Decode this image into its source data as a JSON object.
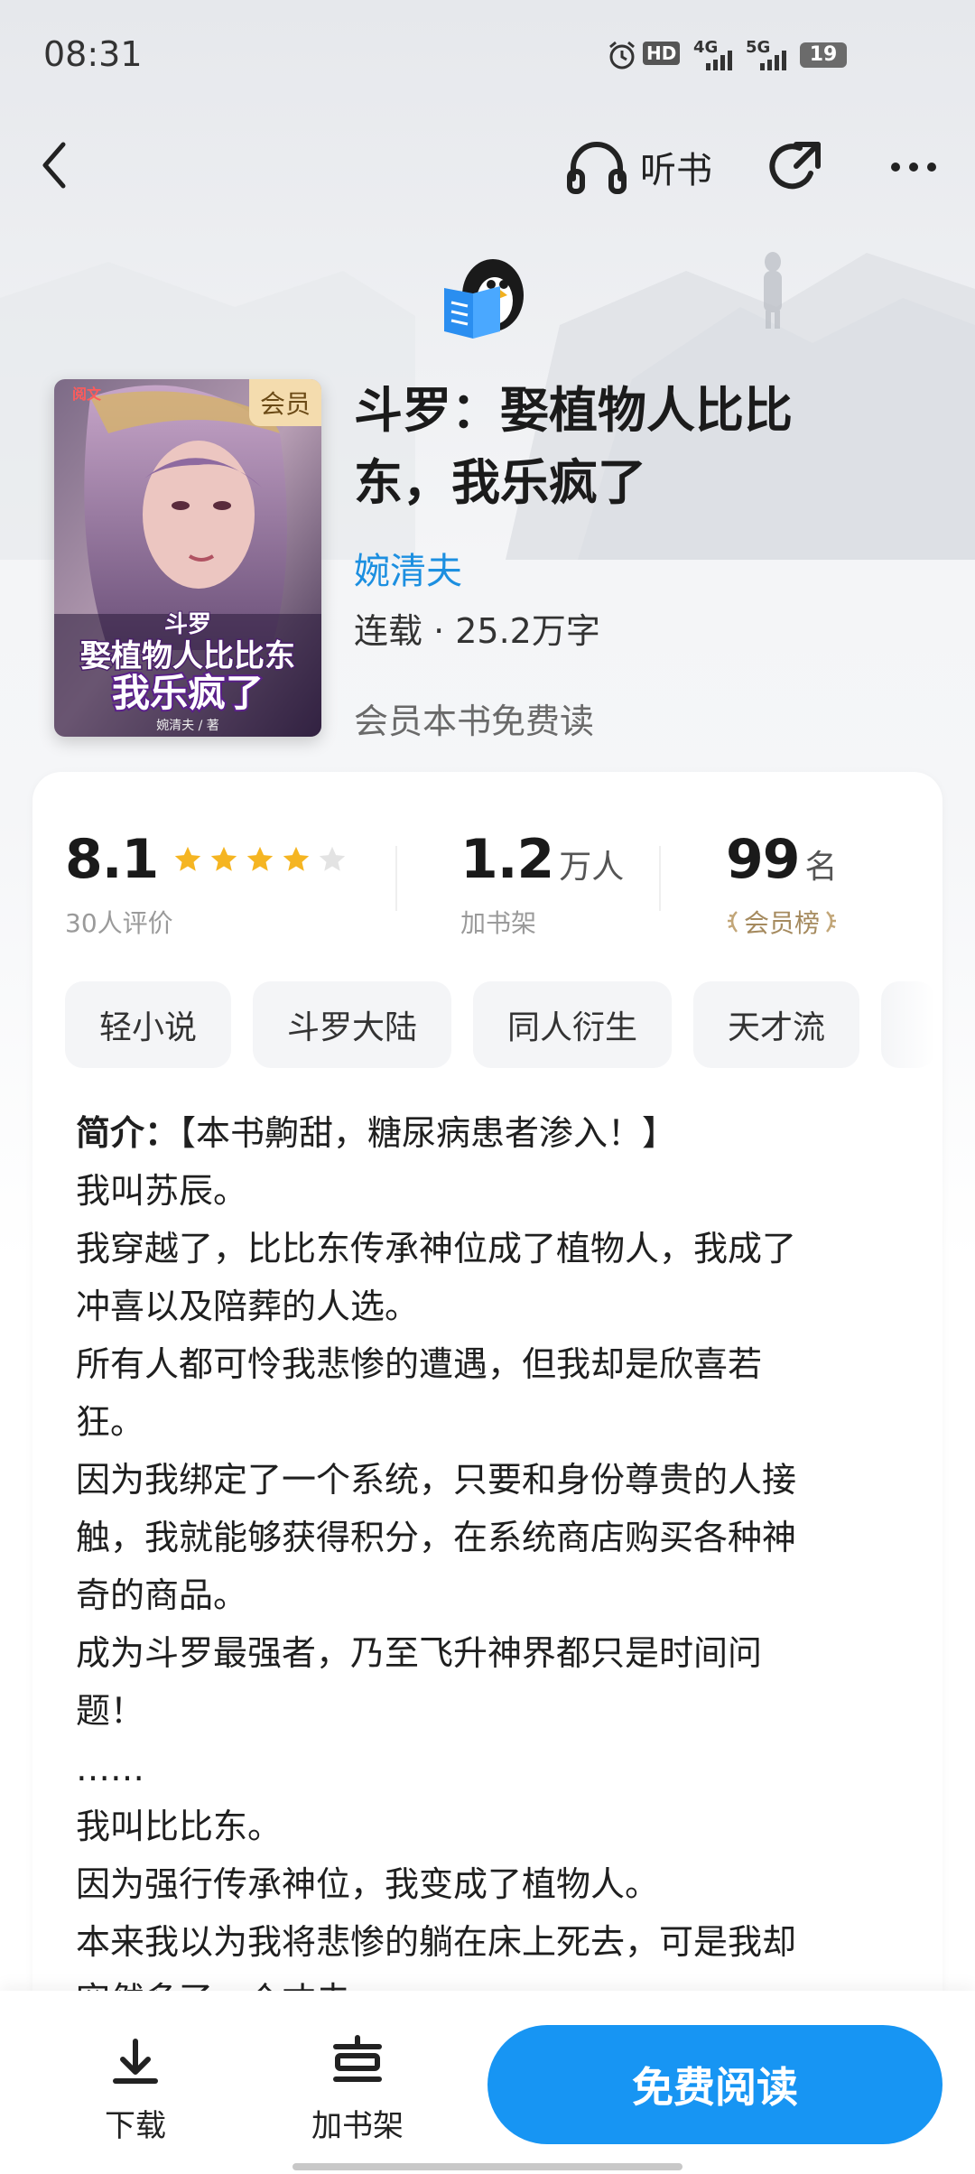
{
  "status_bar": {
    "time": "08:31",
    "network_1": "HD",
    "network_2": "4G",
    "network_3": "5G",
    "battery": "19"
  },
  "nav": {
    "audiobook_label": "听书"
  },
  "book": {
    "cover_badge": "会员",
    "title": "斗罗：娶植物人比比东，我乐疯了",
    "author": "婉清夫",
    "status": "连载 · 25.2万字",
    "free_note": "会员本书免费读"
  },
  "stats": {
    "rating": "8.1",
    "rating_stars": 4,
    "rating_caption": "30人评价",
    "shelf_num": "1.2",
    "shelf_unit": "万人",
    "shelf_caption": "加书架",
    "rank_num": "99",
    "rank_unit": "名",
    "rank_caption": "会员榜"
  },
  "tags": [
    "轻小说",
    "斗罗大陆",
    "同人衍生",
    "天才流"
  ],
  "synopsis": {
    "label": "简介：",
    "lines": [
      "【本书齁甜，糖尿病患者渗入！】",
      "我叫苏辰。",
      "我穿越了，比比东传承神位成了植物人，我成了",
      "冲喜以及陪葬的人选。",
      "所有人都可怜我悲惨的遭遇，但我却是欣喜若",
      "狂。",
      "因为我绑定了一个系统，只要和身份尊贵的人接",
      "触，我就能够获得积分，在系统商店购买各种神",
      "奇的商品。",
      "成为斗罗最强者，乃至飞升神界都只是时间问",
      "题！",
      "……",
      "我叫比比东。",
      "因为强行传承神位，我变成了植物人。",
      "本来我以为我将悲惨的躺在床上死去，可是我却",
      "突然多了一个丈夫。"
    ]
  },
  "bottom_bar": {
    "download_label": "下载",
    "shelf_label": "加书架",
    "read_label": "免费阅读"
  },
  "colors": {
    "accent": "#1795f3",
    "author": "#1c8fe0",
    "star": "#f5b522",
    "rank": "#a58a5e"
  }
}
